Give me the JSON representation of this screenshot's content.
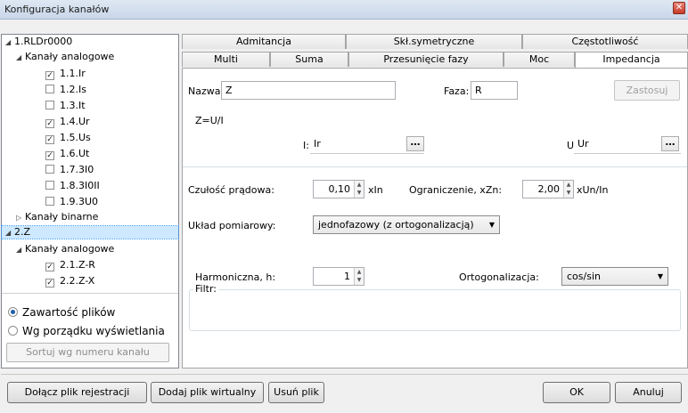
{
  "window": {
    "title": "Konfiguracja kanałów",
    "close_label": "✕"
  },
  "tree": {
    "device": "1.RLDr0000",
    "analog_group": "Kanały analogowe",
    "channels": [
      {
        "label": "1.1.Ir",
        "checked": true
      },
      {
        "label": "1.2.Is",
        "checked": false
      },
      {
        "label": "1.3.It",
        "checked": false
      },
      {
        "label": "1.4.Ur",
        "checked": true
      },
      {
        "label": "1.5.Us",
        "checked": true
      },
      {
        "label": "1.6.Ut",
        "checked": true
      },
      {
        "label": "1.7.3I0",
        "checked": false
      },
      {
        "label": "1.8.3I0II",
        "checked": false
      },
      {
        "label": "1.9.3U0",
        "checked": false
      }
    ],
    "binary_group": "Kanały binarne",
    "virtual": "2.Z",
    "virtual_analog_group": "Kanały analogowe",
    "virtual_channels": [
      {
        "label": "2.1.Z-R",
        "checked": true
      },
      {
        "label": "2.2.Z-X",
        "checked": true
      }
    ],
    "check_glyph": "✓",
    "expanded_glyph": "◢",
    "collapsed_glyph": "▷"
  },
  "order_options": {
    "option1": "Zawartość plików",
    "option2": "Wg porządku wyświetlania",
    "sort_button": "Sortuj wg numeru kanału"
  },
  "tabs": {
    "row1": [
      "Admitancja",
      "Skł.symetryczne",
      "Częstotliwość"
    ],
    "row2": [
      "Multi",
      "Suma",
      "Przesunięcie fazy",
      "Moc",
      "Impedancja"
    ],
    "active": "Impedancja"
  },
  "form": {
    "name_label": "Nazwa:",
    "name_value": "Z",
    "phase_label": "Faza:",
    "phase_value": "R",
    "apply_button": "Zastosuj",
    "formula": "Z=U/I",
    "i_label": "I:",
    "i_value": "Ir",
    "u_label": "U:",
    "u_value": "Ur",
    "browse_label": "…",
    "sensitivity_label": "Czułość prądowa:",
    "sensitivity_value": "0,10",
    "sensitivity_unit": "xIn",
    "limit_label": "Ograniczenie, xZn:",
    "limit_value": "2,00",
    "limit_unit": "xUn/In",
    "measure_label": "Układ pomiarowy:",
    "measure_value": "jednofazowy (z ortogonalizacją)",
    "filter_group": "Filtr:",
    "harmonic_label": "Harmoniczna, h:",
    "harmonic_value": "1",
    "ortho_label": "Ortogonalizacja:",
    "ortho_value": "cos/sin",
    "spin_up": "▲",
    "spin_down": "▼",
    "dropdown_arrow": "▼"
  },
  "buttons": {
    "attach": "Dołącz plik rejestracji",
    "add_virtual": "Dodaj plik wirtualny",
    "remove": "Usuń plik",
    "ok": "OK",
    "cancel": "Anuluj"
  }
}
